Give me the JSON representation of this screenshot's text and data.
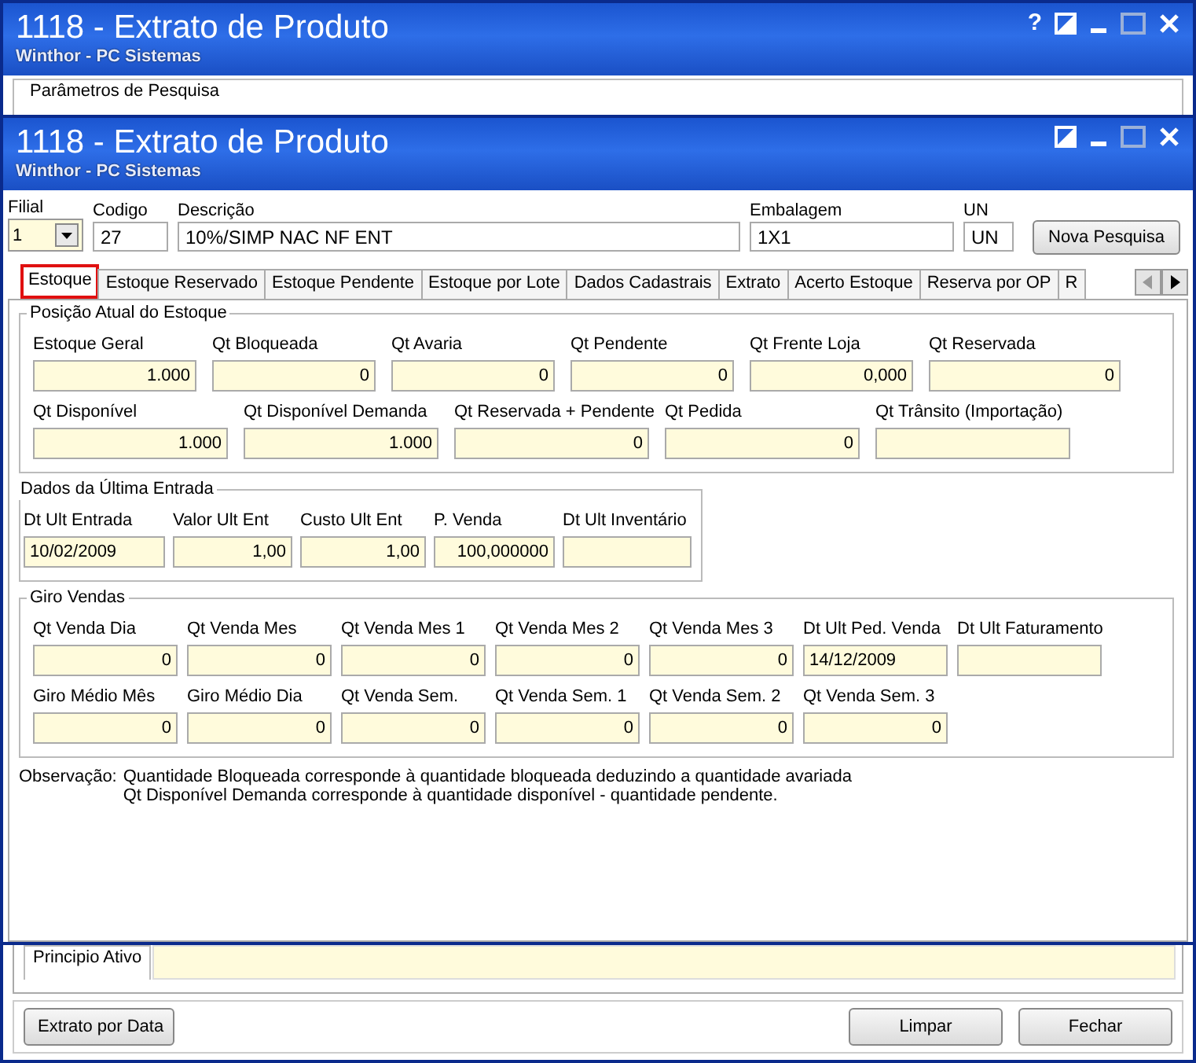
{
  "back_window": {
    "title": "1118 - Extrato de Produto",
    "subtitle": "Winthor - PC Sistemas",
    "help": "?",
    "search_group": {
      "title": "Parâmetros de Pesquisa"
    },
    "active_ingredient": {
      "label": "Principio Ativo"
    },
    "buttons_left": [
      "Extrato por Data"
    ],
    "buttons_right": [
      "Limpar",
      "Fechar"
    ]
  },
  "window": {
    "title": "1118 - Extrato de Produto",
    "subtitle": "Winthor - PC Sistemas",
    "header_fields": [
      {
        "kind": "dropdown",
        "label": "Filial",
        "value": "1"
      },
      {
        "kind": "text",
        "label": "Codigo",
        "value": "27"
      },
      {
        "kind": "text",
        "label": "Descrição",
        "value": "10%/SIMP NAC NF ENT"
      },
      {
        "kind": "text",
        "label": "Embalagem",
        "value": "1X1"
      },
      {
        "kind": "text",
        "label": "UN",
        "value": "UN"
      }
    ],
    "search_button": "Nova Pesquisa",
    "tabs": [
      {
        "label": "Estoque",
        "selected": true,
        "highlighted": true
      },
      {
        "label": "Estoque Reservado",
        "selected": false,
        "highlighted": false
      },
      {
        "label": "Estoque Pendente",
        "selected": false,
        "highlighted": false
      },
      {
        "label": "Estoque por Lote",
        "selected": false,
        "highlighted": false
      },
      {
        "label": "Dados Cadastrais",
        "selected": false,
        "highlighted": false
      },
      {
        "label": "Extrato",
        "selected": false,
        "highlighted": false
      },
      {
        "label": "Acerto Estoque",
        "selected": false,
        "highlighted": false
      },
      {
        "label": "Reserva por OP",
        "selected": false,
        "highlighted": false
      },
      {
        "label": "R",
        "selected": false,
        "highlighted": false
      }
    ],
    "groups": [
      {
        "title": "Posição Atual do Estoque",
        "rows": [
          [
            {
              "label": "Estoque Geral",
              "value": "1.000",
              "kind": "number"
            },
            {
              "label": "Qt Bloqueada",
              "value": "0",
              "kind": "number"
            },
            {
              "label": "Qt Avaria",
              "value": "0",
              "kind": "number"
            },
            {
              "label": "Qt Pendente",
              "value": "0",
              "kind": "number"
            },
            {
              "label": "Qt Frente Loja",
              "value": "0,000",
              "kind": "number"
            },
            {
              "label": "Qt Reservada",
              "value": "0",
              "kind": "number"
            }
          ],
          [
            {
              "label": "Qt Disponível",
              "value": "1.000",
              "kind": "number"
            },
            {
              "label": "Qt Disponível Demanda",
              "value": "1.000",
              "kind": "number"
            },
            {
              "label": "Qt Reservada + Pendente",
              "value": "0",
              "kind": "number"
            },
            {
              "label": "Qt Pedida",
              "value": "0",
              "kind": "number"
            },
            {
              "label": "Qt Trânsito (Importação)",
              "kind": "number"
            }
          ]
        ]
      },
      {
        "title": "Dados da Última Entrada",
        "rows": [
          [
            {
              "label": "Dt Ult Entrada",
              "value": "10/02/2009",
              "kind": "date"
            },
            {
              "label": "Valor Ult Ent",
              "value": "1,00",
              "kind": "number"
            },
            {
              "label": "Custo Ult Ent",
              "value": "1,00",
              "kind": "number"
            },
            {
              "label": "P. Venda",
              "value": "100,000000",
              "kind": "number"
            },
            {
              "label": "Dt Ult Inventário",
              "kind": "date"
            }
          ]
        ]
      },
      {
        "title": "Giro Vendas",
        "rows": [
          [
            {
              "label": "Qt Venda Dia",
              "value": "0",
              "kind": "number"
            },
            {
              "label": "Qt Venda Mes",
              "value": "0",
              "kind": "number"
            },
            {
              "label": "Qt Venda Mes 1",
              "value": "0",
              "kind": "number"
            },
            {
              "label": "Qt Venda Mes 2",
              "value": "0",
              "kind": "number"
            },
            {
              "label": "Qt Venda Mes 3",
              "value": "0",
              "kind": "number"
            },
            {
              "label": "Dt Ult Ped. Venda",
              "value": "14/12/2009",
              "kind": "date"
            },
            {
              "label": "Dt Ult Faturamento",
              "kind": "date"
            }
          ],
          [
            {
              "label": "Giro Médio Mês",
              "value": "0",
              "kind": "number"
            },
            {
              "label": "Giro Médio Dia",
              "value": "0",
              "kind": "number"
            },
            {
              "label": "Qt Venda Sem.",
              "value": "0",
              "kind": "number"
            },
            {
              "label": "Qt Venda Sem. 1",
              "value": "0",
              "kind": "number"
            },
            {
              "label": "Qt Venda Sem. 2",
              "value": "0",
              "kind": "number"
            },
            {
              "label": "Qt Venda Sem. 3",
              "value": "0",
              "kind": "number"
            }
          ]
        ]
      }
    ],
    "note": {
      "label": "Observação:",
      "lines": [
        "Quantidade Bloqueada corresponde à quantidade bloqueada deduzindo a quantidade avariada",
        "Qt Disponível Demanda corresponde à quantidade disponível - quantidade pendente."
      ]
    }
  }
}
